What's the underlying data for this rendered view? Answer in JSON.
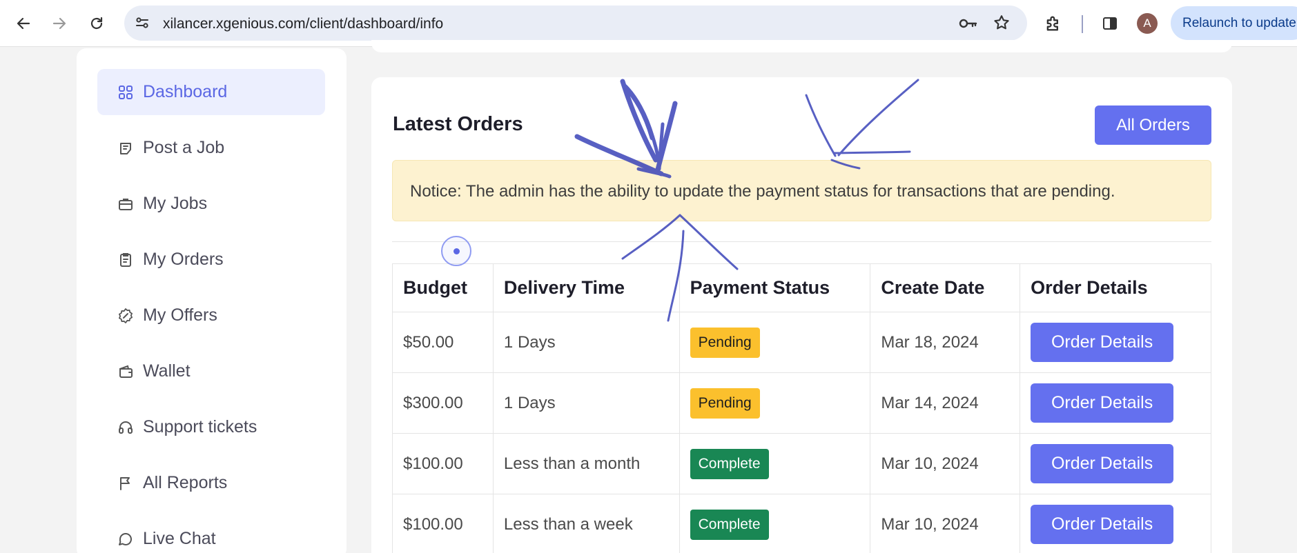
{
  "browser": {
    "url": "xilancer.xgenious.com/client/dashboard/info",
    "relaunch_label": "Relaunch to update",
    "avatar_letter": "A"
  },
  "sidebar": {
    "items": [
      {
        "label": "Dashboard",
        "icon": "grid-icon",
        "active": true
      },
      {
        "label": "Post a Job",
        "icon": "post-job-icon",
        "active": false
      },
      {
        "label": "My Jobs",
        "icon": "briefcase-icon",
        "active": false
      },
      {
        "label": "My Orders",
        "icon": "clipboard-icon",
        "active": false
      },
      {
        "label": "My Offers",
        "icon": "badge-percent-icon",
        "active": false
      },
      {
        "label": "Wallet",
        "icon": "wallet-icon",
        "active": false
      },
      {
        "label": "Support tickets",
        "icon": "headset-icon",
        "active": false
      },
      {
        "label": "All Reports",
        "icon": "flag-icon",
        "active": false
      },
      {
        "label": "Live Chat",
        "icon": "chat-bubble-icon",
        "active": false
      }
    ]
  },
  "orders": {
    "title": "Latest Orders",
    "all_orders_label": "All Orders",
    "notice": "Notice: The admin has the ability to update the payment status for transactions that are pending.",
    "columns": [
      "Budget",
      "Delivery Time",
      "Payment Status",
      "Create Date",
      "Order Details"
    ],
    "rows": [
      {
        "budget": "$50.00",
        "delivery": "1 Days",
        "status": "Pending",
        "date": "Mar 18, 2024",
        "action": "Order Details"
      },
      {
        "budget": "$300.00",
        "delivery": "1 Days",
        "status": "Pending",
        "date": "Mar 14, 2024",
        "action": "Order Details"
      },
      {
        "budget": "$100.00",
        "delivery": "Less than a month",
        "status": "Complete",
        "date": "Mar 10, 2024",
        "action": "Order Details"
      },
      {
        "budget": "$100.00",
        "delivery": "Less than a week",
        "status": "Complete",
        "date": "Mar 10, 2024",
        "action": "Order Details"
      }
    ]
  },
  "colors": {
    "accent": "#6470ef",
    "pending": "#fbc02d",
    "complete": "#198754",
    "notice_bg": "#fdf2d0",
    "scribble": "#3b44b8"
  }
}
